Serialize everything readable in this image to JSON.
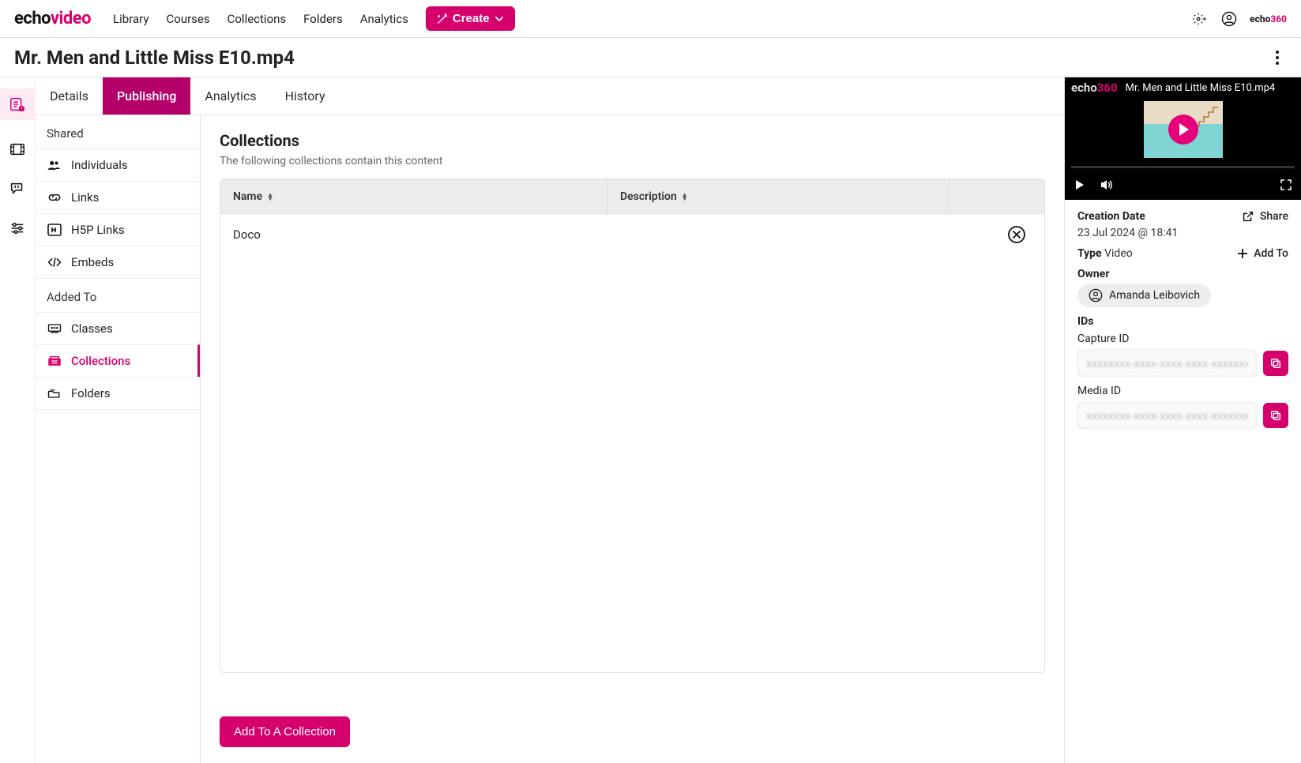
{
  "topnav": {
    "links": [
      "Library",
      "Courses",
      "Collections",
      "Folders",
      "Analytics"
    ],
    "create": "Create"
  },
  "title": "Mr. Men and Little Miss E10.mp4",
  "tabs": [
    "Details",
    "Publishing",
    "Analytics",
    "History"
  ],
  "sidepanel": {
    "shared_label": "Shared",
    "shared_items": [
      "Individuals",
      "Links",
      "H5P Links",
      "Embeds"
    ],
    "added_label": "Added To",
    "added_items": [
      "Classes",
      "Collections",
      "Folders"
    ]
  },
  "content": {
    "heading": "Collections",
    "subtitle": "The following collections contain this content",
    "columns": {
      "name": "Name",
      "desc": "Description"
    },
    "rows": [
      {
        "name": "Doco",
        "desc": ""
      }
    ],
    "add_button": "Add To A Collection"
  },
  "player": {
    "file_title": "Mr. Men and Little Miss E10.mp4"
  },
  "meta": {
    "creation_label": "Creation Date",
    "creation_value": "23 Jul 2024 @ 18:41",
    "share": "Share",
    "type_label": "Type",
    "type_value": "Video",
    "addto": "Add To",
    "owner_label": "Owner",
    "owner_value": "Amanda Leibovich",
    "ids_label": "IDs",
    "capture_label": "Capture ID",
    "capture_value": "xxxxxxxx-xxxx-xxxx-xxxx-xxxxxxxxxx…",
    "media_label": "Media ID",
    "media_value": "xxxxxxxx-xxxx-xxxx-xxxx-xxxxxxxxxx…"
  }
}
